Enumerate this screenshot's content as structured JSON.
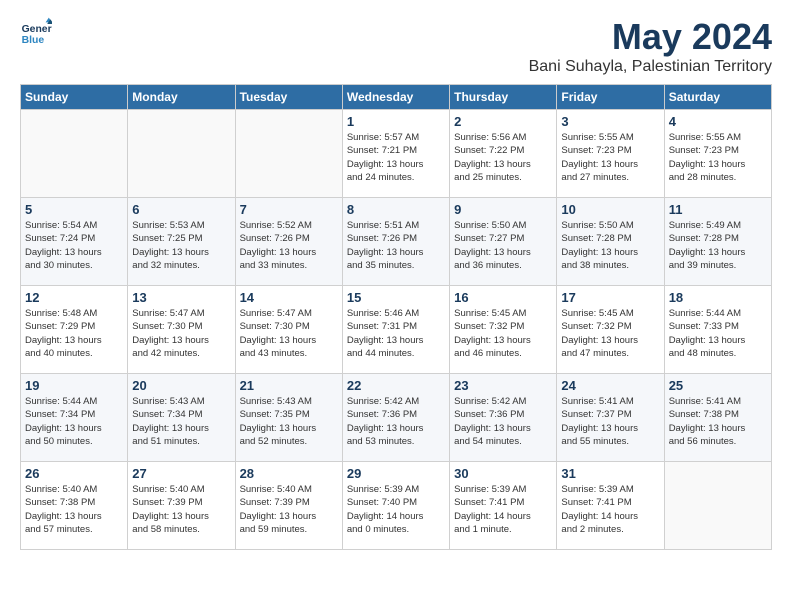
{
  "header": {
    "logo_line1": "General",
    "logo_line2": "Blue",
    "title": "May 2024",
    "subtitle": "Bani Suhayla, Palestinian Territory"
  },
  "days_of_week": [
    "Sunday",
    "Monday",
    "Tuesday",
    "Wednesday",
    "Thursday",
    "Friday",
    "Saturday"
  ],
  "weeks": [
    [
      {
        "num": "",
        "info": ""
      },
      {
        "num": "",
        "info": ""
      },
      {
        "num": "",
        "info": ""
      },
      {
        "num": "1",
        "info": "Sunrise: 5:57 AM\nSunset: 7:21 PM\nDaylight: 13 hours\nand 24 minutes."
      },
      {
        "num": "2",
        "info": "Sunrise: 5:56 AM\nSunset: 7:22 PM\nDaylight: 13 hours\nand 25 minutes."
      },
      {
        "num": "3",
        "info": "Sunrise: 5:55 AM\nSunset: 7:23 PM\nDaylight: 13 hours\nand 27 minutes."
      },
      {
        "num": "4",
        "info": "Sunrise: 5:55 AM\nSunset: 7:23 PM\nDaylight: 13 hours\nand 28 minutes."
      }
    ],
    [
      {
        "num": "5",
        "info": "Sunrise: 5:54 AM\nSunset: 7:24 PM\nDaylight: 13 hours\nand 30 minutes."
      },
      {
        "num": "6",
        "info": "Sunrise: 5:53 AM\nSunset: 7:25 PM\nDaylight: 13 hours\nand 32 minutes."
      },
      {
        "num": "7",
        "info": "Sunrise: 5:52 AM\nSunset: 7:26 PM\nDaylight: 13 hours\nand 33 minutes."
      },
      {
        "num": "8",
        "info": "Sunrise: 5:51 AM\nSunset: 7:26 PM\nDaylight: 13 hours\nand 35 minutes."
      },
      {
        "num": "9",
        "info": "Sunrise: 5:50 AM\nSunset: 7:27 PM\nDaylight: 13 hours\nand 36 minutes."
      },
      {
        "num": "10",
        "info": "Sunrise: 5:50 AM\nSunset: 7:28 PM\nDaylight: 13 hours\nand 38 minutes."
      },
      {
        "num": "11",
        "info": "Sunrise: 5:49 AM\nSunset: 7:28 PM\nDaylight: 13 hours\nand 39 minutes."
      }
    ],
    [
      {
        "num": "12",
        "info": "Sunrise: 5:48 AM\nSunset: 7:29 PM\nDaylight: 13 hours\nand 40 minutes."
      },
      {
        "num": "13",
        "info": "Sunrise: 5:47 AM\nSunset: 7:30 PM\nDaylight: 13 hours\nand 42 minutes."
      },
      {
        "num": "14",
        "info": "Sunrise: 5:47 AM\nSunset: 7:30 PM\nDaylight: 13 hours\nand 43 minutes."
      },
      {
        "num": "15",
        "info": "Sunrise: 5:46 AM\nSunset: 7:31 PM\nDaylight: 13 hours\nand 44 minutes."
      },
      {
        "num": "16",
        "info": "Sunrise: 5:45 AM\nSunset: 7:32 PM\nDaylight: 13 hours\nand 46 minutes."
      },
      {
        "num": "17",
        "info": "Sunrise: 5:45 AM\nSunset: 7:32 PM\nDaylight: 13 hours\nand 47 minutes."
      },
      {
        "num": "18",
        "info": "Sunrise: 5:44 AM\nSunset: 7:33 PM\nDaylight: 13 hours\nand 48 minutes."
      }
    ],
    [
      {
        "num": "19",
        "info": "Sunrise: 5:44 AM\nSunset: 7:34 PM\nDaylight: 13 hours\nand 50 minutes."
      },
      {
        "num": "20",
        "info": "Sunrise: 5:43 AM\nSunset: 7:34 PM\nDaylight: 13 hours\nand 51 minutes."
      },
      {
        "num": "21",
        "info": "Sunrise: 5:43 AM\nSunset: 7:35 PM\nDaylight: 13 hours\nand 52 minutes."
      },
      {
        "num": "22",
        "info": "Sunrise: 5:42 AM\nSunset: 7:36 PM\nDaylight: 13 hours\nand 53 minutes."
      },
      {
        "num": "23",
        "info": "Sunrise: 5:42 AM\nSunset: 7:36 PM\nDaylight: 13 hours\nand 54 minutes."
      },
      {
        "num": "24",
        "info": "Sunrise: 5:41 AM\nSunset: 7:37 PM\nDaylight: 13 hours\nand 55 minutes."
      },
      {
        "num": "25",
        "info": "Sunrise: 5:41 AM\nSunset: 7:38 PM\nDaylight: 13 hours\nand 56 minutes."
      }
    ],
    [
      {
        "num": "26",
        "info": "Sunrise: 5:40 AM\nSunset: 7:38 PM\nDaylight: 13 hours\nand 57 minutes."
      },
      {
        "num": "27",
        "info": "Sunrise: 5:40 AM\nSunset: 7:39 PM\nDaylight: 13 hours\nand 58 minutes."
      },
      {
        "num": "28",
        "info": "Sunrise: 5:40 AM\nSunset: 7:39 PM\nDaylight: 13 hours\nand 59 minutes."
      },
      {
        "num": "29",
        "info": "Sunrise: 5:39 AM\nSunset: 7:40 PM\nDaylight: 14 hours\nand 0 minutes."
      },
      {
        "num": "30",
        "info": "Sunrise: 5:39 AM\nSunset: 7:41 PM\nDaylight: 14 hours\nand 1 minute."
      },
      {
        "num": "31",
        "info": "Sunrise: 5:39 AM\nSunset: 7:41 PM\nDaylight: 14 hours\nand 2 minutes."
      },
      {
        "num": "",
        "info": ""
      }
    ]
  ]
}
